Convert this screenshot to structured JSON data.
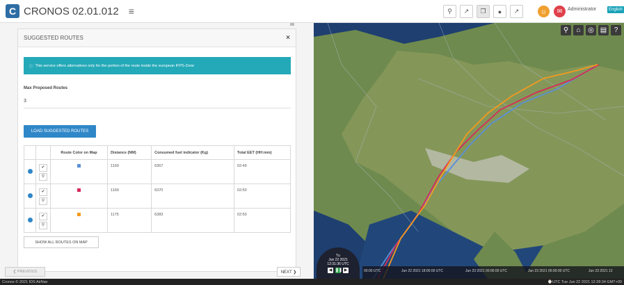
{
  "app": {
    "title": "CRONOS 02.01.012",
    "logo": "C"
  },
  "toolbar": {
    "tools": [
      {
        "name": "location-icon",
        "glyph": "⚲"
      },
      {
        "name": "external-link-icon",
        "glyph": "↗"
      },
      {
        "name": "copy-icon",
        "glyph": "❐"
      },
      {
        "name": "globe-icon",
        "glyph": "●"
      },
      {
        "name": "share-icon",
        "glyph": "↗"
      }
    ],
    "user": "Administrator",
    "language": "English",
    "notif_colors": [
      "#f0a030",
      "#e0404a"
    ]
  },
  "panel": {
    "title": "SUGGESTED ROUTES",
    "close": "×",
    "info": "This service offers alternatives only for the portion of the route inside the european IFPS-Zone",
    "max_label": "Max Proposed Routes",
    "max_value": "3",
    "load_button": "LOAD SUGGESTED ROUTES",
    "table": {
      "headers": [
        "Route Color on Map",
        "Distance (NM)",
        "Consumed fuel indicator (Kg)",
        "Total EET (HH:mm)"
      ],
      "rows": [
        {
          "color": "#5b8fd6",
          "distance": "1169",
          "fuel": "6367",
          "eet": "02:49"
        },
        {
          "color": "#d62a5a",
          "distance": "1169",
          "fuel": "6370",
          "eet": "02:50"
        },
        {
          "color": "#f39a1e",
          "distance": "1175",
          "fuel": "6383",
          "eet": "02:50"
        }
      ]
    },
    "show_all": "SHOW ALL ROUTES ON MAP"
  },
  "nav": {
    "prev": "❮ PREVIOUS",
    "next": "NEXT ❯"
  },
  "map": {
    "clock": {
      "day": "Tu",
      "date": "Jun 22 2021",
      "time": "12:31:36 UTC"
    },
    "timeline": [
      "00:00 UTC",
      "Jun 22 2021 18:00:00 UTC",
      "Jun 23 2021 00:00:00 UTC",
      "Jun 23 2021 06:00:00 UTC",
      "Jun 23 2021 12"
    ]
  },
  "footer": {
    "left": "Cronos © 2021 IDS AirNav",
    "right": "⌚UTC Tue Jun 22 2021 12:28:34 GMT+00"
  }
}
